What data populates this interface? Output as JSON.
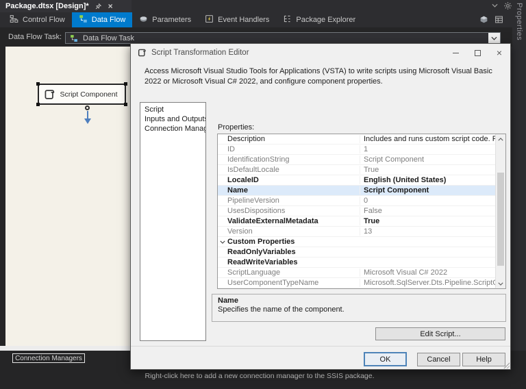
{
  "window": {
    "doc_tab": "Package.dtsx [Design]*",
    "properties_side_tab": "Properties"
  },
  "toolbar": {
    "items": [
      {
        "label": "Control Flow"
      },
      {
        "label": "Data Flow"
      },
      {
        "label": "Parameters"
      },
      {
        "label": "Event Handlers"
      },
      {
        "label": "Package Explorer"
      }
    ]
  },
  "task_selector": {
    "label": "Data Flow Task:",
    "value": "Data Flow Task"
  },
  "design_surface": {
    "component": "Script Component"
  },
  "dialog": {
    "title": "Script Transformation Editor",
    "description": "Access Microsoft Visual Studio Tools for Applications (VSTA) to write scripts using Microsoft Visual Basic 2022 or Microsoft Visual C# 2022, and configure component properties.",
    "nav": [
      "Script",
      "Inputs and Outputs",
      "Connection Managers"
    ],
    "properties_label": "Properties:",
    "grid_rows": [
      {
        "name": "Description",
        "value": "Includes and runs custom script code. For example,"
      },
      {
        "name": "ID",
        "value": "1"
      },
      {
        "name": "IdentificationString",
        "value": "Script Component"
      },
      {
        "name": "IsDefaultLocale",
        "value": "True"
      },
      {
        "name": "LocaleID",
        "value": "English (United States)"
      },
      {
        "name": "Name",
        "value": "Script Component"
      },
      {
        "name": "PipelineVersion",
        "value": "0"
      },
      {
        "name": "UsesDispositions",
        "value": "False"
      },
      {
        "name": "ValidateExternalMetadata",
        "value": "True"
      },
      {
        "name": "Version",
        "value": "13"
      },
      {
        "name": "Custom Properties",
        "value": ""
      },
      {
        "name": "ReadOnlyVariables",
        "value": ""
      },
      {
        "name": "ReadWriteVariables",
        "value": ""
      },
      {
        "name": "ScriptLanguage",
        "value": "Microsoft Visual C# 2022"
      },
      {
        "name": "UserComponentTypeName",
        "value": "Microsoft.SqlServer.Dts.Pipeline.ScriptComponentH"
      }
    ],
    "info": {
      "title": "Name",
      "text": "Specifies the name of the component."
    },
    "buttons": {
      "edit_script": "Edit Script...",
      "ok": "OK",
      "cancel": "Cancel",
      "help": "Help"
    }
  },
  "connection_managers": {
    "tab": "Connection Managers",
    "hint": "Right-click here to add a new connection manager to the SSIS package."
  },
  "colors": {
    "accent_blue": "#007acc",
    "design_surface": "#f4f1e8",
    "vs_dark": "#2d2d30"
  }
}
